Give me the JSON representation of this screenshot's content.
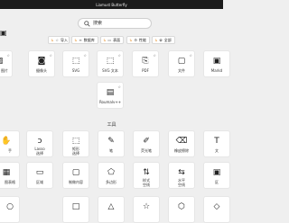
{
  "window": {
    "title": "Liamust Butterfly"
  },
  "search": {
    "placeholder": "搜索",
    "value": "搜索"
  },
  "toolbar": [
    {
      "label": "导入",
      "icon": "star-icon"
    },
    {
      "label": "数据库",
      "icon": "database-icon"
    },
    {
      "label": "表面",
      "icon": "surface-icon"
    },
    {
      "label": "性能",
      "icon": "performance-icon"
    },
    {
      "label": "全部",
      "icon": "all-icon"
    }
  ],
  "formats": [
    {
      "label": "图片",
      "icon": "image-icon"
    },
    {
      "label": "摄像头",
      "icon": "camera-icon"
    },
    {
      "label": "SVG",
      "icon": "svg-icon"
    },
    {
      "label": "SVG 文本",
      "icon": "svg-text-icon"
    },
    {
      "label": "PDF",
      "icon": "pdf-icon"
    },
    {
      "label": "文件",
      "icon": "file-icon"
    },
    {
      "label": "Markd",
      "icon": "markdown-icon"
    }
  ],
  "formats_row2": [
    {
      "label": "Roumalv++",
      "icon": "frame-icon"
    }
  ],
  "tools_title": "工具",
  "tools_row1": [
    {
      "label": "手",
      "icon": "hand-icon"
    },
    {
      "label": "Lasso\n选择",
      "icon": "lasso-icon"
    },
    {
      "label": "矩形\n选择",
      "icon": "rect-select-icon"
    },
    {
      "label": "笔",
      "icon": "pen-icon"
    },
    {
      "label": "荧光笔",
      "icon": "highlighter-icon"
    },
    {
      "label": "橡皮擦除",
      "icon": "eraser-icon"
    },
    {
      "label": "文",
      "icon": "text-icon"
    }
  ],
  "tools_row2": [
    {
      "label": "图表格",
      "icon": "table-icon"
    },
    {
      "label": "区域",
      "icon": "region-icon"
    },
    {
      "label": "制做内容",
      "icon": "content-icon"
    },
    {
      "label": "多边形",
      "icon": "polygon-icon"
    },
    {
      "label": "样式\n空线",
      "icon": "line-style-icon"
    },
    {
      "label": "水平\n空线",
      "icon": "horizontal-line-icon"
    },
    {
      "label": "区",
      "icon": "zone-icon"
    }
  ],
  "tools_row3": [
    {
      "label": "",
      "icon": "circle-icon"
    },
    {
      "label": "",
      "icon": "square-icon"
    },
    {
      "label": "",
      "icon": "triangle-icon"
    },
    {
      "label": "",
      "icon": "star-shape-icon"
    },
    {
      "label": "",
      "icon": "hexagon-icon"
    },
    {
      "label": "",
      "icon": "diamond-icon"
    }
  ]
}
